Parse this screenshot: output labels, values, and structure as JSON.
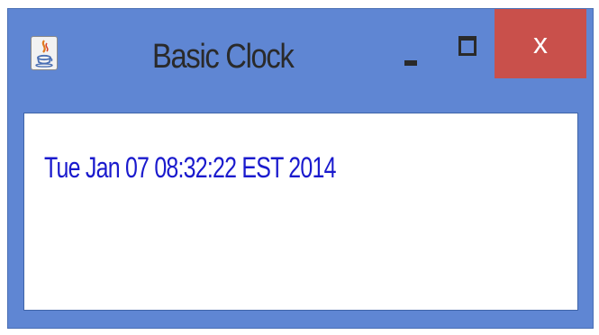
{
  "window": {
    "title": "Basic Clock",
    "icon": "java-cup-icon",
    "controls": {
      "minimize_icon": "minimize-icon",
      "maximize_icon": "maximize-icon",
      "close_label": "x"
    },
    "colors": {
      "frame": "#5f86d3",
      "close_button": "#c9504b",
      "content_background": "#ffffff"
    }
  },
  "content": {
    "clock_text": "Tue Jan 07 08:32:22 EST 2014",
    "clock_color": "#1a1acd"
  }
}
